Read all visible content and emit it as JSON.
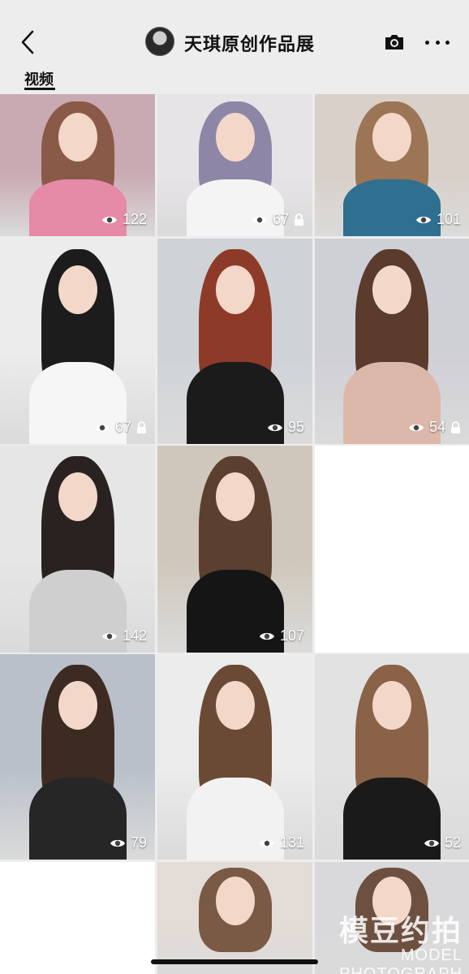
{
  "header": {
    "title": "天琪原创作品展",
    "tab_label": "视频"
  },
  "grid": {
    "items": [
      {
        "views": "122",
        "locked": false,
        "bg": "#c9a9b2",
        "hair": "#8a5a48",
        "top": "#e58aa7"
      },
      {
        "views": "67",
        "locked": true,
        "bg": "#e7e4e7",
        "hair": "#8e86a6",
        "top": "#f4f4f4"
      },
      {
        "views": "101",
        "locked": false,
        "bg": "#d8d0c9",
        "hair": "#9b7555",
        "top": "#2f6f8f"
      },
      {
        "views": "67",
        "locked": true,
        "bg": "#ececec",
        "hair": "#1c1c1c",
        "top": "#f6f6f6"
      },
      {
        "views": "95",
        "locked": false,
        "bg": "#cfd3d8",
        "hair": "#8d3b28",
        "top": "#1b1b1b"
      },
      {
        "views": "54",
        "locked": true,
        "bg": "#cfcfd6",
        "hair": "#5a3b2c",
        "top": "#dcb8aa"
      },
      {
        "views": "142",
        "locked": false,
        "bg": "#e6e6e6",
        "hair": "#2a2220",
        "top": "#cfcfcf"
      },
      {
        "views": "107",
        "locked": false,
        "bg": "#cfc7bb",
        "hair": "#5b3f2f",
        "top": "#151515"
      },
      {
        "empty": true
      },
      {
        "views": "79",
        "locked": false,
        "bg": "#b9c0ca",
        "hair": "#3d2b22",
        "top": "#262626"
      },
      {
        "views": "131",
        "locked": false,
        "bg": "#ececec",
        "hair": "#6b4a35",
        "top": "#f2f2f2"
      },
      {
        "views": "52",
        "locked": false,
        "bg": "#e2e2e2",
        "hair": "#8a6248",
        "top": "#1a1a1a"
      },
      {
        "empty": true
      },
      {
        "partial": true,
        "bg": "#e4dcd6",
        "hair": "#7a5a44"
      },
      {
        "partial": true,
        "bg": "#d9d9db",
        "hair": "#6d5040"
      }
    ]
  },
  "watermark": {
    "main": "模豆约拍",
    "sub": "MODEL PHOTOGRAPH"
  }
}
